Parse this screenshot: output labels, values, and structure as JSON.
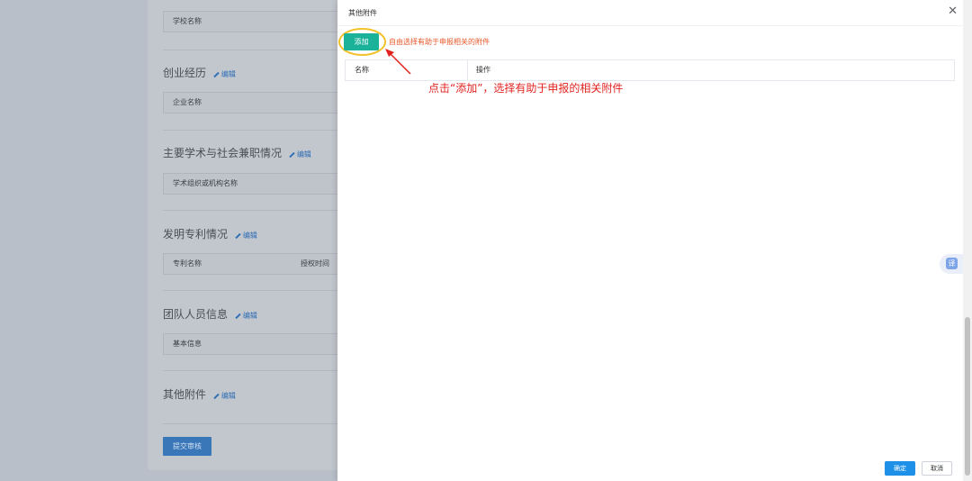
{
  "background_form": {
    "school_header": "学校名称",
    "sections": [
      {
        "title": "创业经历",
        "edit": "编辑",
        "col1": "企业名称",
        "col2": ""
      },
      {
        "title": "主要学术与社会兼职情况",
        "edit": "编辑",
        "col1": "学术组织或机构名称",
        "col2": ""
      },
      {
        "title": "发明专利情况",
        "edit": "编辑",
        "col1": "专利名称",
        "col2": "授权时间"
      },
      {
        "title": "团队人员信息",
        "edit": "编辑",
        "col1": "基本信息",
        "col2": ""
      },
      {
        "title": "其他附件",
        "edit": "编辑"
      }
    ],
    "submit_label": "提交审核"
  },
  "drawer": {
    "title": "其他附件",
    "close_icon": "close-icon",
    "add_label": "添加",
    "hint": "自由选择有助于申报相关的附件",
    "table_headers": [
      "名称",
      "操作"
    ],
    "annotation": "点击“添加”，选择有助于申报的相关附件",
    "ok_label": "确定",
    "cancel_label": "取消"
  },
  "float_widget": {
    "label": "译"
  },
  "colors": {
    "accent_teal": "#1bb29a",
    "primary_blue": "#1e90e8",
    "annotation_red": "#e1241f",
    "highlight_yellow": "#f3c12a"
  }
}
